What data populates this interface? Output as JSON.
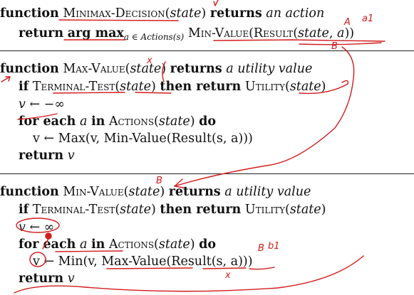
{
  "block1": {
    "line1": {
      "kw_function": "function",
      "name": "Minimax-Decision",
      "param": "state",
      "kw_returns": "returns",
      "ret": "an action"
    },
    "line2": {
      "kw_return": "return",
      "argmax": "arg max",
      "sub": "a ∈ Actions(s)",
      "call": "Min-Value(Result(",
      "arg_state": "state",
      "arg_sep": ", ",
      "arg_a": "a",
      "close": "))"
    }
  },
  "block2": {
    "line1": {
      "kw_function": "function",
      "name": "Max-Value",
      "param": "state",
      "kw_returns": "returns",
      "ret": "a utility value"
    },
    "line2": {
      "kw_if": "if",
      "test": "Terminal-Test",
      "param": "state",
      "kw_then": "then return",
      "util": "Utility",
      "util_param": "state"
    },
    "line3": "v ← −∞",
    "line4": {
      "kw_for": "for each",
      "var": "a",
      "kw_in": "in",
      "actions": "Actions",
      "param": "state",
      "kw_do": "do"
    },
    "line5": "v ← Max(v, Min-Value(Result(s, a)))",
    "line6": {
      "kw_return": "return",
      "var": "v"
    }
  },
  "block3": {
    "line1": {
      "kw_function": "function",
      "name": "Min-Value",
      "param": "state",
      "kw_returns": "returns",
      "ret": "a utility value"
    },
    "line2": {
      "kw_if": "if",
      "test": "Terminal-Test",
      "param": "state",
      "kw_then": "then return",
      "util": "Utility",
      "util_param": "state"
    },
    "line3": "v ← ∞",
    "line4": {
      "kw_for": "for each",
      "var": "a",
      "kw_in": "in",
      "actions": "Actions",
      "param": "state",
      "kw_do": "do"
    },
    "line5": "v ← Min(v, Max-Value(Result(s, a)))",
    "line6": {
      "kw_return": "return",
      "var": "v"
    }
  },
  "annotations": {
    "a_label": "A",
    "a1_label": "a1",
    "b_label": "B",
    "x_mark1": "x",
    "b_arrow": "B",
    "b2_label": "B",
    "b1_label": "b1",
    "x_mark2": "x"
  },
  "colors": {
    "ink": "#d41c1c",
    "text": "#111111"
  }
}
